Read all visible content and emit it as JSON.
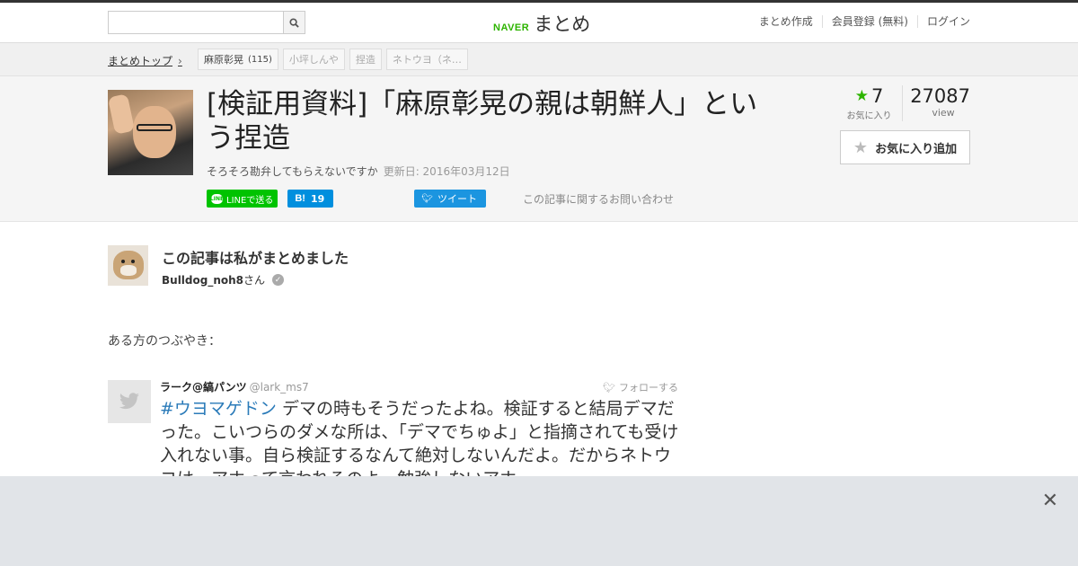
{
  "header": {
    "search": {
      "value": "",
      "placeholder": ""
    },
    "brand": {
      "naver": "NAVER",
      "matome": "まとめ"
    },
    "links": [
      "まとめ作成",
      "会員登録 (無料)",
      "ログイン"
    ]
  },
  "breadcrumb": {
    "home": "まとめトップ",
    "tags": [
      {
        "label": "麻原彰晃",
        "count": "(115)"
      },
      {
        "label": "小坪しんや"
      },
      {
        "label": "捏造"
      },
      {
        "label": "ネトウヨ（ネ…"
      }
    ]
  },
  "article": {
    "title": "[検証用資料]「麻原彰晃の親は朝鮮人」という捏造",
    "description": "そろそろ勘弁してもらえないですか",
    "updated": "更新日: 2016年03月12日",
    "share": {
      "line": "LINEで送る",
      "hatena_count": "19",
      "tweet": "ツイート",
      "inquiry": "この記事に関するお問い合わせ"
    },
    "stats": {
      "favorites": "7",
      "favorites_label": "お気に入り",
      "views": "27087",
      "views_label": "view"
    },
    "fav_button": "お気に入り追加"
  },
  "author": {
    "heading": "この記事は私がまとめました",
    "name": "Bulldog_noh8",
    "suffix": "さん"
  },
  "content": {
    "intro": "ある方のつぶやき："
  },
  "tweet": {
    "name": "ラーク@縞パンツ",
    "handle": "@lark_ms7",
    "follow": "フォローする",
    "hashtag": "#ウヨマゲドン",
    "text": " デマの時もそうだったよね。検証すると結局デマだった。こいつらのダメな所は、「デマでちゅよ」と指摘されても受け入れない事。自ら検証するなんて絶対しないんだよ。だからネトウヨは、アホって言われるのよ。勉強しないアホ。"
  },
  "colors": {
    "naver_green": "#2db400",
    "line_green": "#00c300",
    "hatena_blue": "#008fde",
    "twitter_blue": "#1b95e0",
    "hashtag_blue": "#2b7bb9"
  }
}
